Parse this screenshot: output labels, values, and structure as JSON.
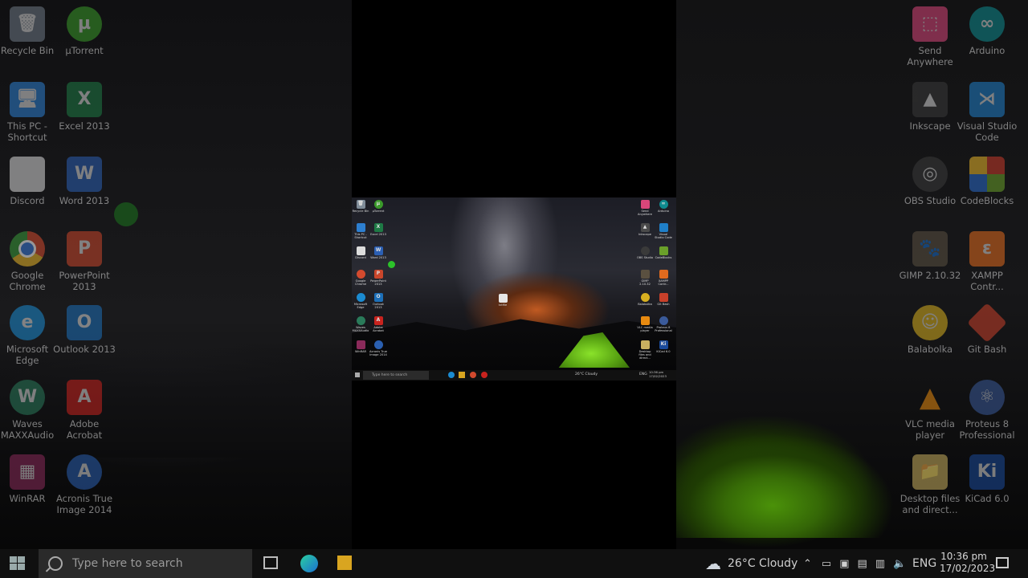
{
  "left_icons": [
    {
      "label": "Recycle Bin",
      "glyph": "🗑",
      "color": "#7f8c99"
    },
    {
      "label": "µTorrent",
      "glyph": "µ",
      "color": "#3a9a2a"
    },
    {
      "label": "This PC - Shortcut",
      "glyph": "🖥",
      "color": "#2d7fd0"
    },
    {
      "label": "Excel 2013",
      "glyph": "X",
      "color": "#1e7a45"
    },
    {
      "label": "Discord",
      "glyph": "",
      "color": "#dcdcdc"
    },
    {
      "label": "Word 2013",
      "glyph": "W",
      "color": "#2b5fb3"
    },
    {
      "label": "Google Chrome",
      "glyph": "◉",
      "color": "#d34a2e"
    },
    {
      "label": "PowerPoint 2013",
      "glyph": "P",
      "color": "#c9462b"
    },
    {
      "label": "Microsoft Edge",
      "glyph": "e",
      "color": "#1b8bd1"
    },
    {
      "label": "Outlook 2013",
      "glyph": "O",
      "color": "#1c6fb8"
    },
    {
      "label": "Waves MAXXAudio",
      "glyph": "W",
      "color": "#2a7a5a"
    },
    {
      "label": "Adobe Acrobat",
      "glyph": "A",
      "color": "#c8231e"
    },
    {
      "label": "WinRAR",
      "glyph": "▦",
      "color": "#8a2a5a"
    },
    {
      "label": "Acronis True Image 2014",
      "glyph": "A",
      "color": "#2a5fb0"
    }
  ],
  "right_icons": [
    {
      "label": "Send Anywhere",
      "glyph": "⬚",
      "color": "#d8467a"
    },
    {
      "label": "Arduino",
      "glyph": "∞",
      "color": "#0e8a8f"
    },
    {
      "label": "Inkscape",
      "glyph": "▲",
      "color": "#4a4a4a"
    },
    {
      "label": "Visual Studio Code",
      "glyph": "⋊",
      "color": "#1f7fc8"
    },
    {
      "label": "OBS Studio",
      "glyph": "◎",
      "color": "#3a3a3a"
    },
    {
      "label": "CodeBlocks",
      "glyph": "▦",
      "color": "#6aa02a"
    },
    {
      "label": "GIMP 2.10.32",
      "glyph": "🐾",
      "color": "#5a5040"
    },
    {
      "label": "XAMPP Contr...",
      "glyph": "ɛ",
      "color": "#e06a1e"
    },
    {
      "label": "Balabolka",
      "glyph": "☺",
      "color": "#d8b020"
    },
    {
      "label": "Git Bash",
      "glyph": "◆",
      "color": "#c8402a"
    },
    {
      "label": "VLC media player",
      "glyph": "▲",
      "color": "#e88a10"
    },
    {
      "label": "Proteus 8 Professional",
      "glyph": "⚛",
      "color": "#3a5a9a"
    },
    {
      "label": "Desktop files and direct...",
      "glyph": "📁",
      "color": "#c9b060"
    },
    {
      "label": "KiCad 6.0",
      "glyph": "Ki",
      "color": "#1a4a9a"
    }
  ],
  "taskbar": {
    "search_placeholder": "Type here to search",
    "weather": "26°C  Cloudy",
    "language": "ENG",
    "time": "10:36 pm",
    "date": "17/02/2023"
  },
  "mini_center_file": "txtfile"
}
